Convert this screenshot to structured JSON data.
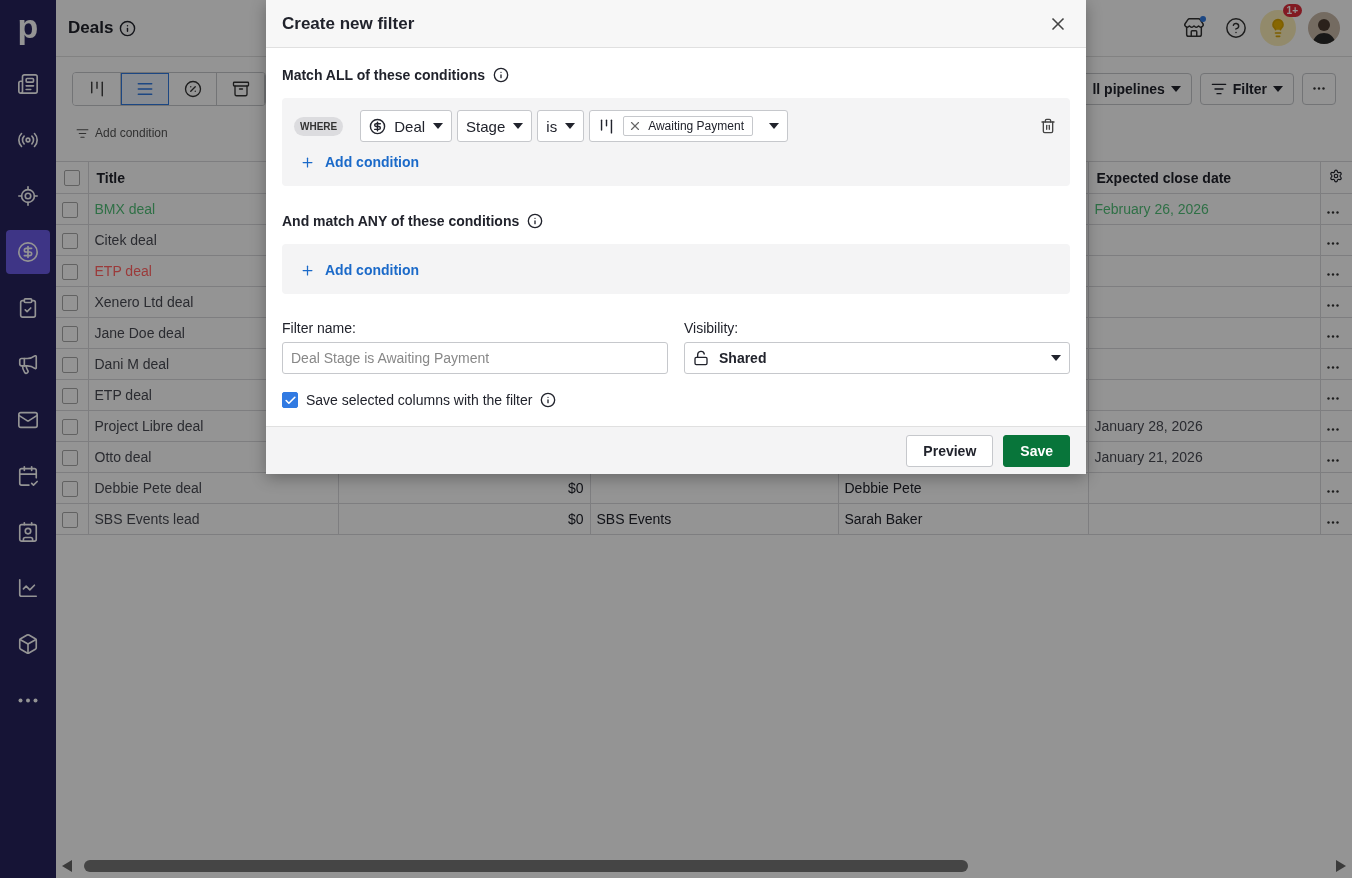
{
  "app": {
    "logo": "p"
  },
  "sidebar": {
    "items": [
      {
        "selected": false
      },
      {
        "selected": false
      },
      {
        "selected": false
      },
      {
        "selected": true
      },
      {
        "selected": false
      },
      {
        "selected": false
      },
      {
        "selected": false
      },
      {
        "selected": false
      },
      {
        "selected": false
      },
      {
        "selected": false
      },
      {
        "selected": false
      },
      {
        "selected": false
      }
    ]
  },
  "header": {
    "title": "Deals",
    "notification_badge": "1+"
  },
  "toolbar": {
    "views": [
      {
        "selected": false
      },
      {
        "selected": true
      },
      {
        "selected": false
      },
      {
        "selected": false
      }
    ],
    "add_condition": "Add condition",
    "pipeline": "ll pipelines",
    "filter": "Filter"
  },
  "table": {
    "columns": [
      "Title",
      "Expected close date"
    ],
    "rows": [
      {
        "checked": false,
        "title": "BMX deal",
        "color": "#2f7046",
        "close_date": "February 26, 2026"
      },
      {
        "checked": false,
        "title": "Citek deal",
        "color": "#2a2b30"
      },
      {
        "checked": false,
        "title": "ETP deal",
        "color": "#9b3a3a"
      },
      {
        "checked": false,
        "title": "Xenero Ltd deal",
        "color": "#2a2b30"
      },
      {
        "checked": false,
        "title": "Jane Doe deal",
        "color": "#2a2b30"
      },
      {
        "checked": false,
        "title": "Dani M deal",
        "color": "#2a2b30"
      },
      {
        "checked": false,
        "title": "ETP deal",
        "color": "#2a2b30"
      },
      {
        "checked": false,
        "title": "Project Libre deal",
        "color": "#2a2b30",
        "close_date": "January 28, 2026"
      },
      {
        "checked": false,
        "title": "Otto deal",
        "color": "#2a2b30",
        "close_date": "January 21, 2026"
      },
      {
        "checked": false,
        "title": "Debbie Pete deal",
        "color": "#2a2b30",
        "column_2": "$0",
        "column_4": "Debbie Pete"
      },
      {
        "checked": false,
        "title": "SBS Events lead",
        "color": "#2a2b30",
        "column_2": "$0",
        "column_3": "SBS Events",
        "column_4": "Sarah Baker"
      }
    ],
    "all_checked": false
  },
  "dialog": {
    "title": "Create new filter",
    "all_section": {
      "heading": "Match ALL of these conditions",
      "conditions": [
        {
          "where": "WHERE",
          "object": "Deal",
          "field": "Stage",
          "operator": "is",
          "values": [
            "Awaiting Payment"
          ]
        }
      ],
      "add": "Add condition"
    },
    "any_section": {
      "heading": "And match ANY of these conditions",
      "add": "Add condition"
    },
    "filter_name": {
      "label": "Filter name:",
      "placeholder": "Deal Stage is Awaiting Payment"
    },
    "visibility": {
      "label": "Visibility:",
      "value": "Shared"
    },
    "save_columns": {
      "label": "Save selected columns with the filter",
      "checked": true
    },
    "buttons": {
      "preview": "Preview",
      "save": "Save"
    }
  }
}
